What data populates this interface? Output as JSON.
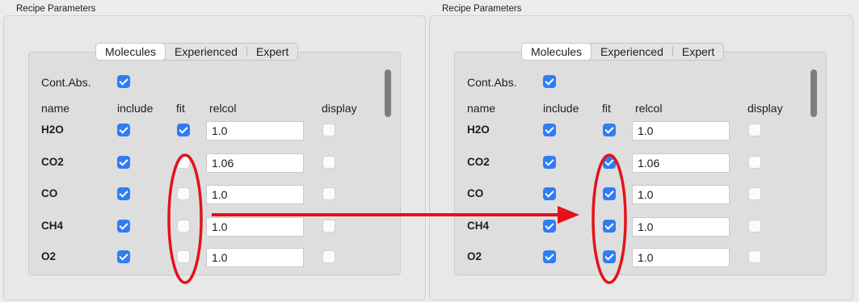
{
  "panel_title": "Recipe Parameters",
  "tabs": [
    "Molecules",
    "Experienced",
    "Expert"
  ],
  "cont_abs_label": "Cont.Abs.",
  "headers": {
    "name": "name",
    "include": "include",
    "fit": "fit",
    "relcol": "relcol",
    "display": "display"
  },
  "panels": [
    {
      "cont_abs_checked": true,
      "rows": [
        {
          "name": "H2O",
          "include": true,
          "fit": true,
          "relcol": "1.0",
          "display": false
        },
        {
          "name": "CO2",
          "include": true,
          "fit": false,
          "relcol": "1.06",
          "display": false
        },
        {
          "name": "CO",
          "include": true,
          "fit": false,
          "relcol": "1.0",
          "display": false
        },
        {
          "name": "CH4",
          "include": true,
          "fit": false,
          "relcol": "1.0",
          "display": false
        },
        {
          "name": "O2",
          "include": true,
          "fit": false,
          "relcol": "1.0",
          "display": false
        }
      ]
    },
    {
      "cont_abs_checked": true,
      "rows": [
        {
          "name": "H2O",
          "include": true,
          "fit": true,
          "relcol": "1.0",
          "display": false
        },
        {
          "name": "CO2",
          "include": true,
          "fit": true,
          "relcol": "1.06",
          "display": false
        },
        {
          "name": "CO",
          "include": true,
          "fit": true,
          "relcol": "1.0",
          "display": false
        },
        {
          "name": "CH4",
          "include": true,
          "fit": true,
          "relcol": "1.0",
          "display": false
        },
        {
          "name": "O2",
          "include": true,
          "fit": true,
          "relcol": "1.0",
          "display": false
        }
      ]
    }
  ],
  "colors": {
    "checkbox_on": "#2f7cf6",
    "annotation": "#e3131b"
  }
}
